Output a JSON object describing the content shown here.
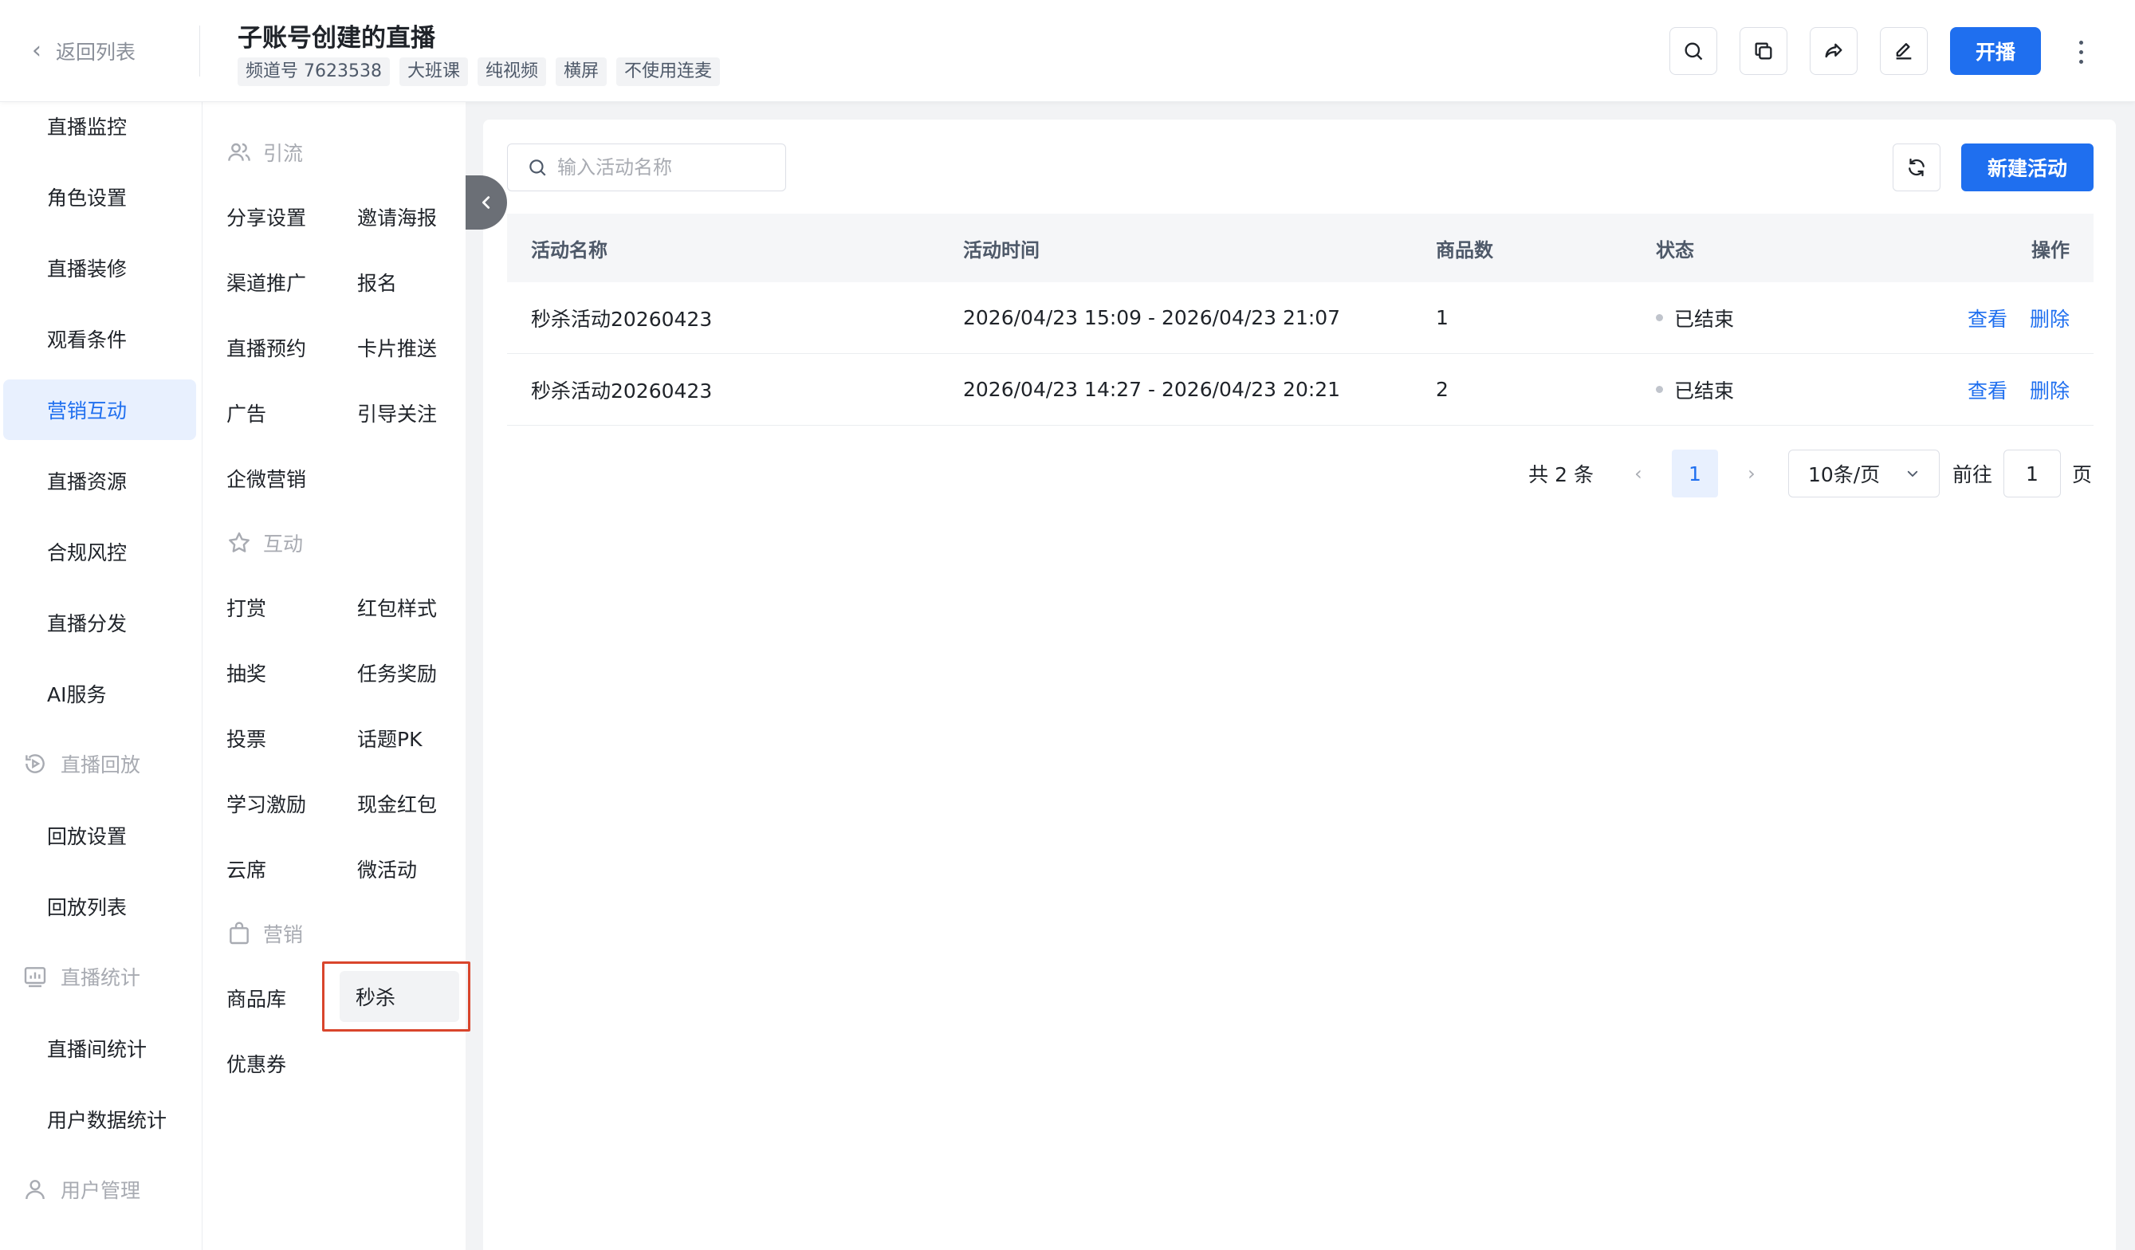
{
  "header": {
    "back_label": "返回列表",
    "title": "子账号创建的直播",
    "tags": [
      "频道号 7623538",
      "大班课",
      "纯视频",
      "横屏",
      "不使用连麦"
    ],
    "live_button": "开播"
  },
  "leftnav": {
    "items": [
      {
        "label": "直播监控",
        "type": "item"
      },
      {
        "label": "角色设置",
        "type": "item"
      },
      {
        "label": "直播装修",
        "type": "item"
      },
      {
        "label": "观看条件",
        "type": "item"
      },
      {
        "label": "营销互动",
        "type": "item",
        "active": true
      },
      {
        "label": "直播资源",
        "type": "item"
      },
      {
        "label": "合规风控",
        "type": "item"
      },
      {
        "label": "直播分发",
        "type": "item"
      },
      {
        "label": "AI服务",
        "type": "item"
      },
      {
        "label": "直播回放",
        "type": "group",
        "icon": "replay-icon"
      },
      {
        "label": "回放设置",
        "type": "item"
      },
      {
        "label": "回放列表",
        "type": "item"
      },
      {
        "label": "直播统计",
        "type": "group",
        "icon": "chart-icon"
      },
      {
        "label": "直播间统计",
        "type": "item"
      },
      {
        "label": "用户数据统计",
        "type": "item"
      },
      {
        "label": "用户管理",
        "type": "group",
        "icon": "user-icon"
      }
    ]
  },
  "subnav": {
    "groups": {
      "traffic": "引流",
      "interaction": "互动",
      "marketing": "营销"
    },
    "traffic_items": [
      "分享设置",
      "邀请海报",
      "渠道推广",
      "报名",
      "直播预约",
      "卡片推送",
      "广告",
      "引导关注",
      "企微营销"
    ],
    "interaction_items": [
      "打赏",
      "红包样式",
      "抽奖",
      "任务奖励",
      "投票",
      "话题PK",
      "学习激励",
      "现金红包",
      "云席",
      "微活动"
    ],
    "marketing_items": [
      "商品库",
      "秒杀",
      "优惠券"
    ],
    "selected": "秒杀"
  },
  "main": {
    "search_placeholder": "输入活动名称",
    "new_button": "新建活动",
    "columns": [
      "活动名称",
      "活动时间",
      "商品数",
      "状态",
      "操作"
    ],
    "rows": [
      {
        "name": "秒杀活动20260423",
        "time": "2026/04/23 15:09 - 2026/04/23 21:07",
        "count": "1",
        "status": "已结束",
        "view": "查看",
        "delete": "删除"
      },
      {
        "name": "秒杀活动20260423",
        "time": "2026/04/23 14:27 - 2026/04/23 20:21",
        "count": "2",
        "status": "已结束",
        "view": "查看",
        "delete": "删除"
      }
    ],
    "pagination": {
      "total": "共 2 条",
      "current_page": "1",
      "page_size": "10条/页",
      "goto_label": "前往",
      "goto_value": "1",
      "page_suffix": "页"
    }
  },
  "colors": {
    "primary": "#1f6fef",
    "active_bg": "#e8f0fe",
    "highlight": "#d9452c"
  }
}
